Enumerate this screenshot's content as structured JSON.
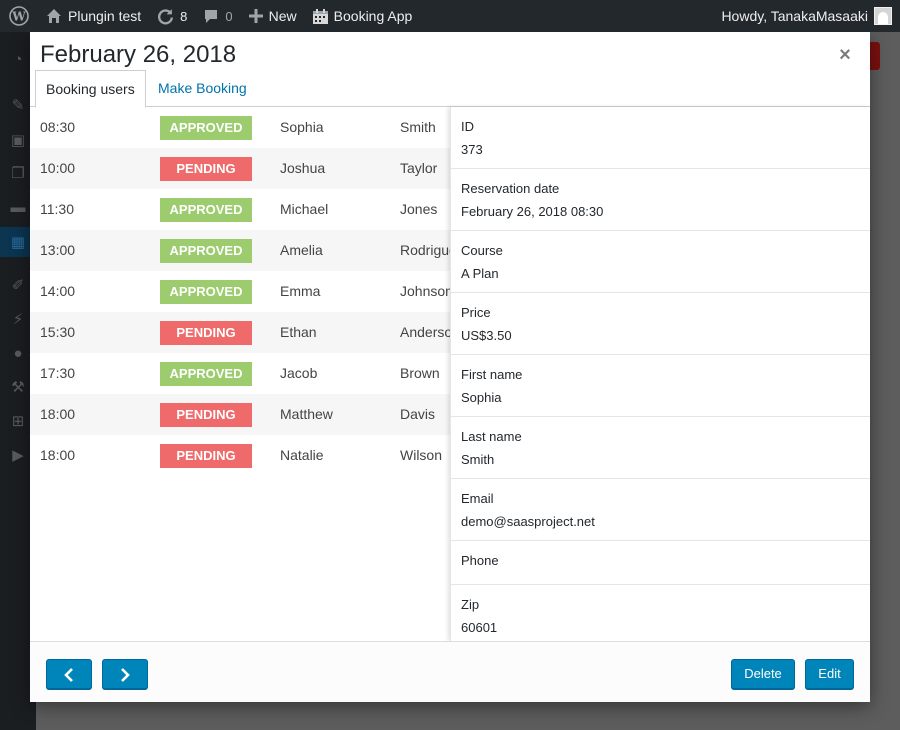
{
  "admin_bar": {
    "site_name": "Plungin test",
    "updates_count": "8",
    "comments_count": "0",
    "new_label": "New",
    "app_name": "Booking App",
    "greeting": "Howdy, TanakaMasaaki"
  },
  "sidebar": {
    "icons": [
      "dashboard-icon",
      "pin-icon",
      "media-icon",
      "pages-icon",
      "comments-icon",
      "calendar-icon",
      "appearance-icon",
      "plugins-icon",
      "users-icon",
      "tools-icon",
      "settings-icon",
      "play-icon"
    ],
    "active": "calendar-icon"
  },
  "modal": {
    "title": "February 26, 2018",
    "tabs": [
      {
        "label": "Booking users",
        "active": true
      },
      {
        "label": "Make Booking",
        "active": false
      }
    ]
  },
  "bookings": [
    {
      "time": "08:30",
      "status": "APPROVED",
      "first_name": "Sophia",
      "last_name": "Smith"
    },
    {
      "time": "10:00",
      "status": "PENDING",
      "first_name": "Joshua",
      "last_name": "Taylor"
    },
    {
      "time": "11:30",
      "status": "APPROVED",
      "first_name": "Michael",
      "last_name": "Jones"
    },
    {
      "time": "13:00",
      "status": "APPROVED",
      "first_name": "Amelia",
      "last_name": "Rodriguez"
    },
    {
      "time": "14:00",
      "status": "APPROVED",
      "first_name": "Emma",
      "last_name": "Johnson"
    },
    {
      "time": "15:30",
      "status": "PENDING",
      "first_name": "Ethan",
      "last_name": "Anderson"
    },
    {
      "time": "17:30",
      "status": "APPROVED",
      "first_name": "Jacob",
      "last_name": "Brown"
    },
    {
      "time": "18:00",
      "status": "PENDING",
      "first_name": "Matthew",
      "last_name": "Davis"
    },
    {
      "time": "18:00",
      "status": "PENDING",
      "first_name": "Natalie",
      "last_name": "Wilson"
    }
  ],
  "status_colors": {
    "APPROVED": "#9ccc6e",
    "PENDING": "#ef6a6a"
  },
  "details": [
    {
      "label": "ID",
      "value": "373"
    },
    {
      "label": "Reservation date",
      "value": "February 26, 2018 08:30"
    },
    {
      "label": "Course",
      "value": "A Plan"
    },
    {
      "label": "Price",
      "value": "US$3.50"
    },
    {
      "label": "First name",
      "value": "Sophia"
    },
    {
      "label": "Last name",
      "value": "Smith"
    },
    {
      "label": "Email",
      "value": "demo@saasproject.net"
    },
    {
      "label": "Phone",
      "value": ""
    },
    {
      "label": "Zip",
      "value": "60601"
    }
  ],
  "footer": {
    "prev_icon": "chevron-left-icon",
    "next_icon": "chevron-right-icon",
    "delete_label": "Delete",
    "edit_label": "Edit"
  }
}
